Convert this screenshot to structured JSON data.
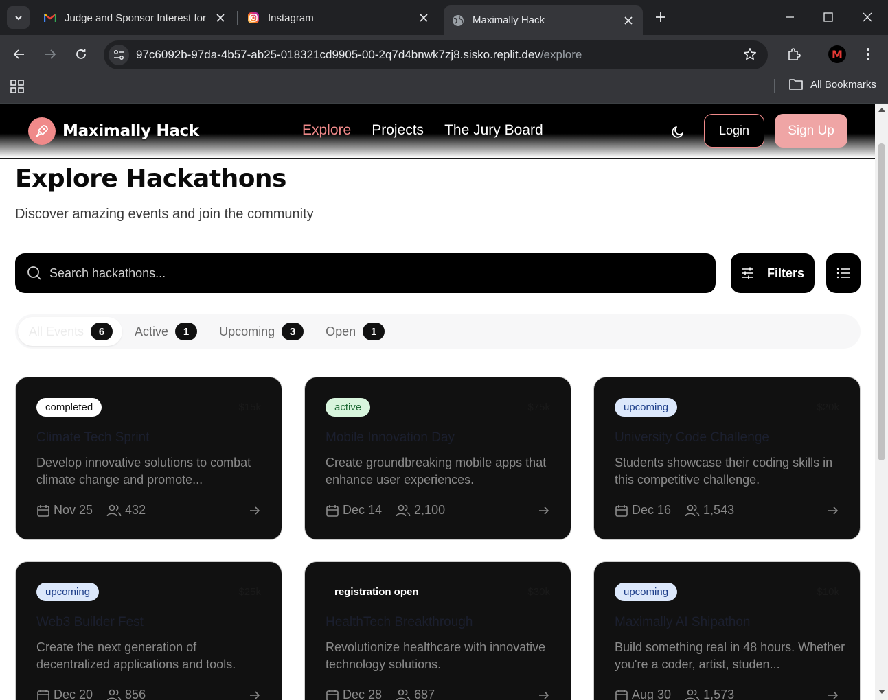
{
  "browser": {
    "tabs": [
      {
        "title": "Judge and Sponsor Interest for",
        "icon": "gmail-icon"
      },
      {
        "title": "Instagram",
        "icon": "instagram-icon"
      },
      {
        "title": "Maximally Hack",
        "icon": "globe-icon",
        "active": true
      }
    ],
    "url_host": "97c6092b-97da-4b57-ab25-018321cd9905-00-2q7d4bnwk7zj8.sisko.replit.dev",
    "url_path": "/explore",
    "bookmarks_label": "All Bookmarks",
    "profile_initial": "M"
  },
  "site": {
    "brand": "Maximally Hack",
    "nav": [
      "Explore",
      "Projects",
      "The Jury Board"
    ],
    "login": "Login",
    "signup": "Sign Up",
    "accent": "#f08a8a"
  },
  "page": {
    "title": "Explore Hackathons",
    "subtitle": "Discover amazing events and join the community",
    "search_placeholder": "Search hackathons...",
    "filters_label": "Filters"
  },
  "filter_tabs": [
    {
      "label": "All Events",
      "count": "6"
    },
    {
      "label": "Active",
      "count": "1"
    },
    {
      "label": "Upcoming",
      "count": "3"
    },
    {
      "label": "Open",
      "count": "1"
    }
  ],
  "cards": [
    {
      "status": "completed",
      "prize": "$15k",
      "title": "Climate Tech Sprint",
      "description": "Develop innovative solutions to combat climate change and promote...",
      "date": "Nov 25",
      "participants": "432"
    },
    {
      "status": "active",
      "prize": "$75k",
      "title": "Mobile Innovation Day",
      "description": "Create groundbreaking mobile apps that enhance user experiences.",
      "date": "Dec 14",
      "participants": "2,100"
    },
    {
      "status": "upcoming",
      "prize": "$20k",
      "title": "University Code Challenge",
      "description": "Students showcase their coding skills in this competitive challenge.",
      "date": "Dec 16",
      "participants": "1,543"
    },
    {
      "status": "upcoming",
      "prize": "$25k",
      "title": "Web3 Builder Fest",
      "description": "Create the next generation of decentralized applications and tools.",
      "date": "Dec 20",
      "participants": "856"
    },
    {
      "status": "registration open",
      "prize": "$30k",
      "title": "HealthTech Breakthrough",
      "description": "Revolutionize healthcare with innovative technology solutions.",
      "date": "Dec 28",
      "participants": "687"
    },
    {
      "status": "upcoming",
      "prize": "$10k",
      "title": "Maximally AI Shipathon",
      "description": "Build something real in 48 hours. Whether you're a coder, artist, studen...",
      "date": "Aug 30",
      "participants": "1,573"
    }
  ]
}
